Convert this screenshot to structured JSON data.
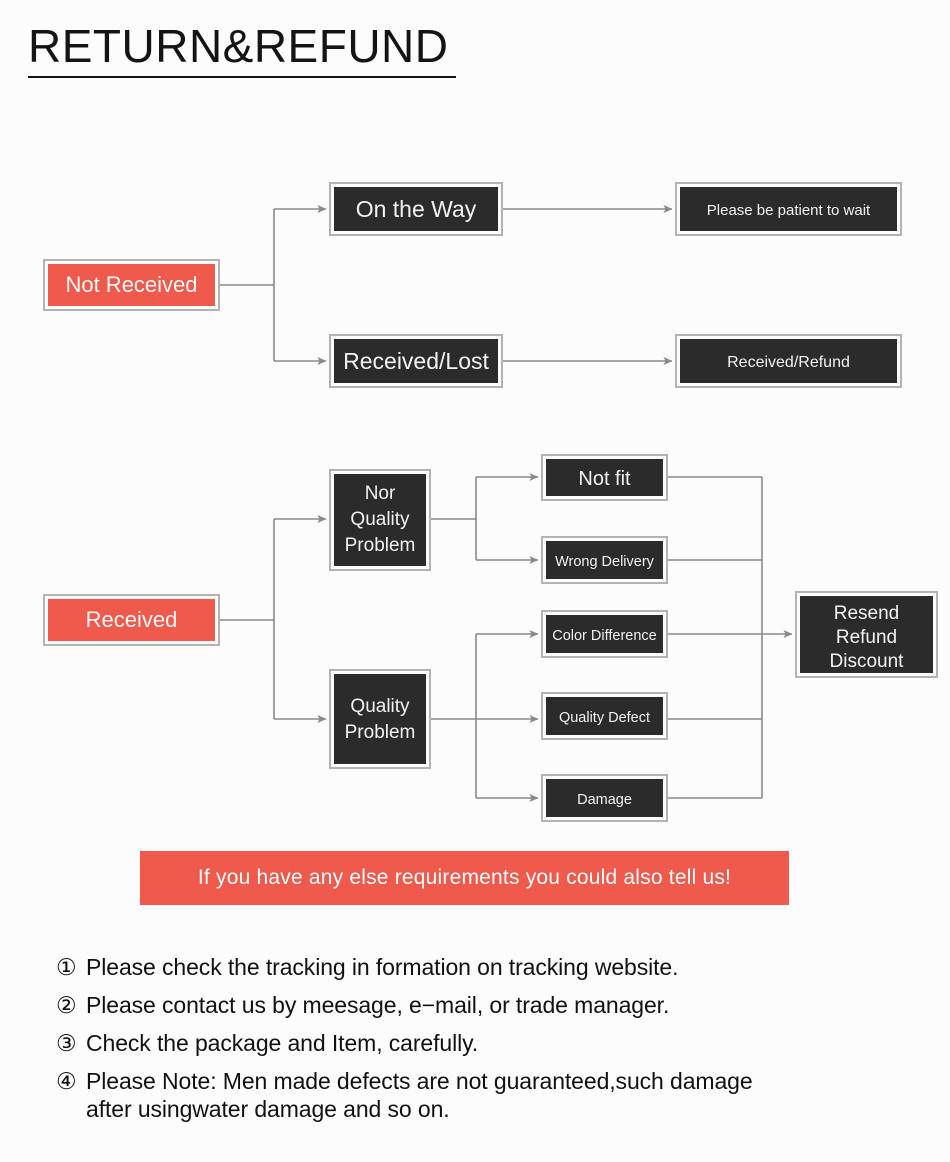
{
  "header": {
    "title": "RETURN&REFUND"
  },
  "colors": {
    "accent_red": "#f05a4c",
    "node_dark": "#2b2b2b",
    "node_border": "#b3b3b3",
    "connector": "#8a8a8a",
    "background": "#fdfcfc",
    "text_light": "#f2f2f2",
    "text_dark": "#111111"
  },
  "flow": {
    "branch_not_received": {
      "root": {
        "label": "Not Received",
        "style": "red"
      },
      "children": [
        {
          "label": "On the Way",
          "style": "dark",
          "next": {
            "label": "Please be patient to wait",
            "style": "dark"
          }
        },
        {
          "label": "Received/Lost",
          "style": "dark",
          "next": {
            "label": "Received/Refund",
            "style": "dark"
          }
        }
      ]
    },
    "branch_received": {
      "root": {
        "label": "Received",
        "style": "red"
      },
      "categories": [
        {
          "label_lines": [
            "Nor",
            "Quality",
            "Problem"
          ],
          "style": "dark",
          "reasons": [
            "Not fit",
            "Wrong Delivery"
          ]
        },
        {
          "label_lines": [
            "Quality",
            "Problem"
          ],
          "style": "dark",
          "reasons": [
            "Color Difference",
            "Quality Defect",
            "Damage"
          ]
        }
      ],
      "reason_nodes": [
        {
          "label": "Not fit",
          "size": "large"
        },
        {
          "label": "Wrong Delivery",
          "size": "small"
        },
        {
          "label": "Color Difference",
          "size": "small"
        },
        {
          "label": "Quality Defect",
          "size": "small"
        },
        {
          "label": "Damage",
          "size": "small"
        }
      ],
      "outcome": {
        "label_lines": [
          "Resend",
          "Refund",
          "Discount"
        ],
        "style": "dark"
      }
    }
  },
  "banner": {
    "text": "If you have any else requirements you could also tell us!"
  },
  "notes": [
    {
      "marker": "①",
      "line1": "Please check the tracking in formation on tracking website.",
      "line2": ""
    },
    {
      "marker": "②",
      "line1": "Please contact us by meesage, e−mail, or trade manager.",
      "line2": ""
    },
    {
      "marker": "③",
      "line1": "Check the package and Item, carefully.",
      "line2": ""
    },
    {
      "marker": "④",
      "line1": "Please Note: Men made defects are not guaranteed,such damage",
      "line2": "after usingwater damage and so on."
    }
  ]
}
